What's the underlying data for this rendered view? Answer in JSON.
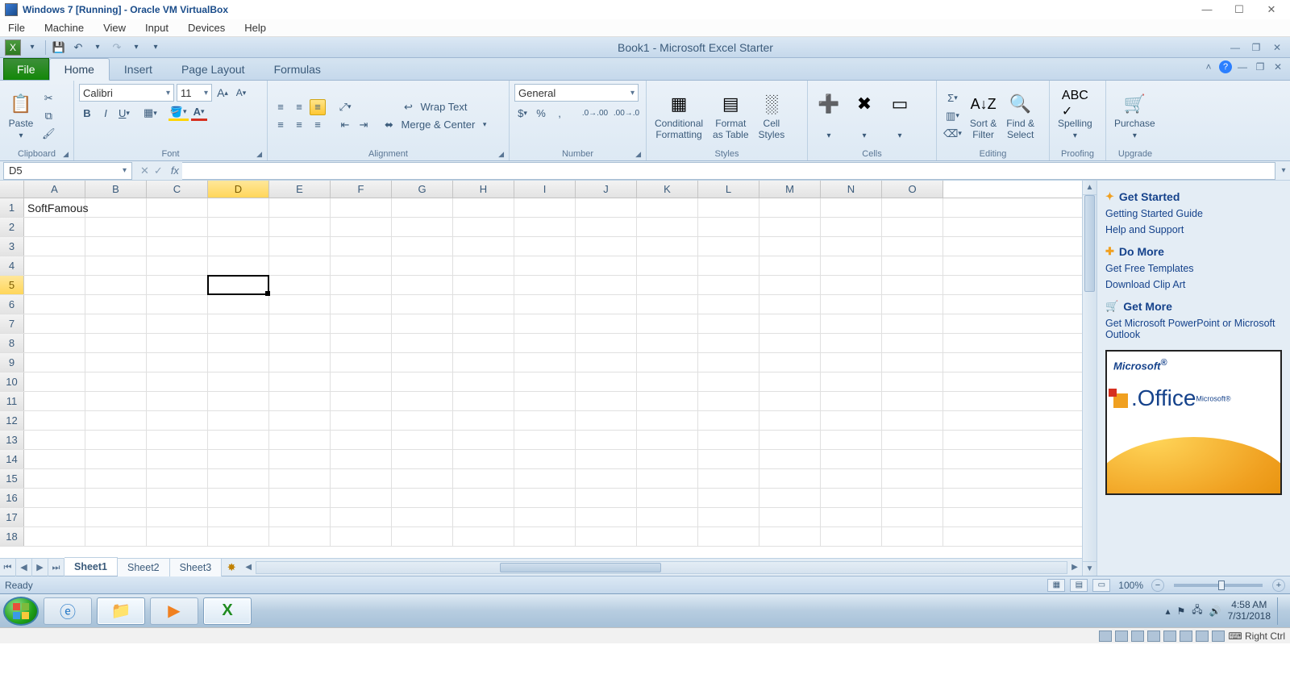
{
  "vb": {
    "title": "Windows 7 [Running] - Oracle VM VirtualBox",
    "menu": [
      "File",
      "Machine",
      "View",
      "Input",
      "Devices",
      "Help"
    ],
    "status_key": "Right Ctrl"
  },
  "excel": {
    "title": "Book1  -  Microsoft Excel Starter",
    "tabs": {
      "file": "File",
      "home": "Home",
      "insert": "Insert",
      "page_layout": "Page Layout",
      "formulas": "Formulas"
    },
    "groups": {
      "clipboard": "Clipboard",
      "font": "Font",
      "alignment": "Alignment",
      "number": "Number",
      "styles": "Styles",
      "cells": "Cells",
      "editing": "Editing",
      "proofing": "Proofing",
      "upgrade": "Upgrade"
    },
    "clipboard": {
      "paste": "Paste"
    },
    "font": {
      "name": "Calibri",
      "size": "11"
    },
    "alignment": {
      "wrap": "Wrap Text",
      "merge": "Merge & Center"
    },
    "number": {
      "format": "General"
    },
    "styles": {
      "cond": "Conditional\nFormatting",
      "table": "Format\nas Table",
      "cell": "Cell\nStyles"
    },
    "cells": {
      "A1": "SoftFamous"
    },
    "editing": {
      "sort": "Sort &\nFilter",
      "find": "Find &\nSelect"
    },
    "proofing": {
      "spelling": "Spelling"
    },
    "upgrade": {
      "purchase": "Purchase"
    },
    "namebox": "D5",
    "columns": [
      "A",
      "B",
      "C",
      "D",
      "E",
      "F",
      "G",
      "H",
      "I",
      "J",
      "K",
      "L",
      "M",
      "N",
      "O"
    ],
    "rows": 18,
    "active": {
      "col": "D",
      "row": 5,
      "col_index": 3
    },
    "sheets": [
      "Sheet1",
      "Sheet2",
      "Sheet3"
    ],
    "status_left": "Ready",
    "zoom": "100%"
  },
  "sidepanel": {
    "h1": "Get Started",
    "l1": "Getting Started Guide",
    "l2": "Help and Support",
    "h2": "Do More",
    "l3": "Get Free Templates",
    "l4": "Download Clip Art",
    "h3": "Get More",
    "l5": "Get Microsoft PowerPoint or Microsoft Outlook",
    "tile_ms": "Microsoft",
    "tile_office": "Office"
  },
  "taskbar": {
    "time": "4:58 AM",
    "date": "7/31/2018"
  }
}
